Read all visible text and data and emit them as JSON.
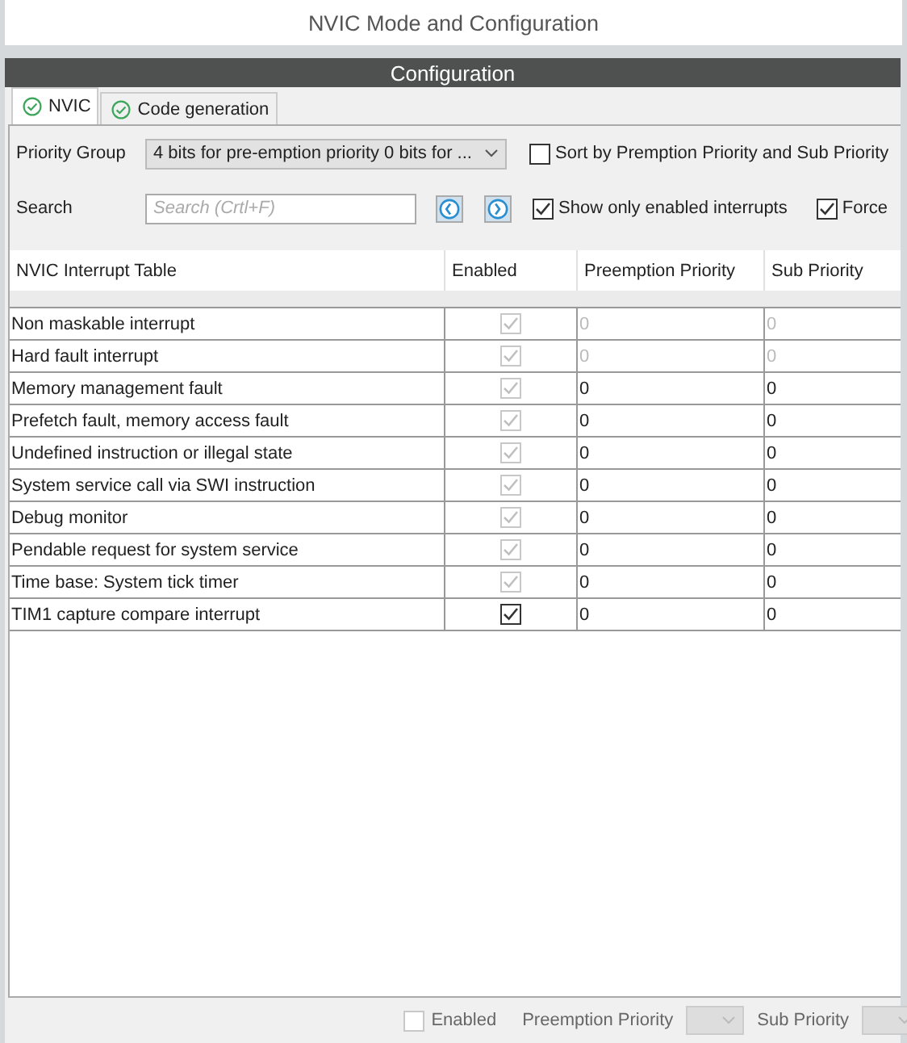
{
  "window": {
    "title": "NVIC Mode and Configuration"
  },
  "section_header": "Configuration",
  "tabs": [
    {
      "label": "NVIC",
      "selected": true
    },
    {
      "label": "Code generation",
      "selected": false
    }
  ],
  "priority_group": {
    "label": "Priority Group",
    "value": "4 bits for pre-emption priority 0 bits for ..."
  },
  "sort_option": {
    "label": "Sort by Premption Priority and Sub Priority",
    "checked": false
  },
  "search": {
    "label": "Search",
    "placeholder": "Search (Crtl+F)"
  },
  "show_enabled_option": {
    "label": "Show only enabled interrupts",
    "checked": true
  },
  "force_option": {
    "label": "Force",
    "checked": true
  },
  "table": {
    "columns": [
      "NVIC Interrupt Table",
      "Enabled",
      "Preemption Priority",
      "Sub Priority"
    ],
    "rows": [
      {
        "name": "Non maskable interrupt",
        "enabled": true,
        "disabled": true,
        "preemption": "0",
        "sub": "0",
        "priority_disabled": true
      },
      {
        "name": "Hard fault interrupt",
        "enabled": true,
        "disabled": true,
        "preemption": "0",
        "sub": "0",
        "priority_disabled": true
      },
      {
        "name": "Memory management fault",
        "enabled": true,
        "disabled": true,
        "preemption": "0",
        "sub": "0",
        "priority_disabled": false
      },
      {
        "name": "Prefetch fault, memory access fault",
        "enabled": true,
        "disabled": true,
        "preemption": "0",
        "sub": "0",
        "priority_disabled": false
      },
      {
        "name": "Undefined instruction or illegal state",
        "enabled": true,
        "disabled": true,
        "preemption": "0",
        "sub": "0",
        "priority_disabled": false
      },
      {
        "name": "System service call via SWI instruction",
        "enabled": true,
        "disabled": true,
        "preemption": "0",
        "sub": "0",
        "priority_disabled": false
      },
      {
        "name": "Debug monitor",
        "enabled": true,
        "disabled": true,
        "preemption": "0",
        "sub": "0",
        "priority_disabled": false
      },
      {
        "name": "Pendable request for system service",
        "enabled": true,
        "disabled": true,
        "preemption": "0",
        "sub": "0",
        "priority_disabled": false
      },
      {
        "name": "Time base: System tick timer",
        "enabled": true,
        "disabled": true,
        "preemption": "0",
        "sub": "0",
        "priority_disabled": false
      },
      {
        "name": "TIM1 capture compare interrupt",
        "enabled": true,
        "disabled": false,
        "preemption": "0",
        "sub": "0",
        "priority_disabled": false
      }
    ]
  },
  "footer": {
    "enabled": {
      "label": "Enabled",
      "checked": false,
      "disabled": true
    },
    "preemption_label": "Preemption Priority",
    "sub_label": "Sub Priority"
  }
}
